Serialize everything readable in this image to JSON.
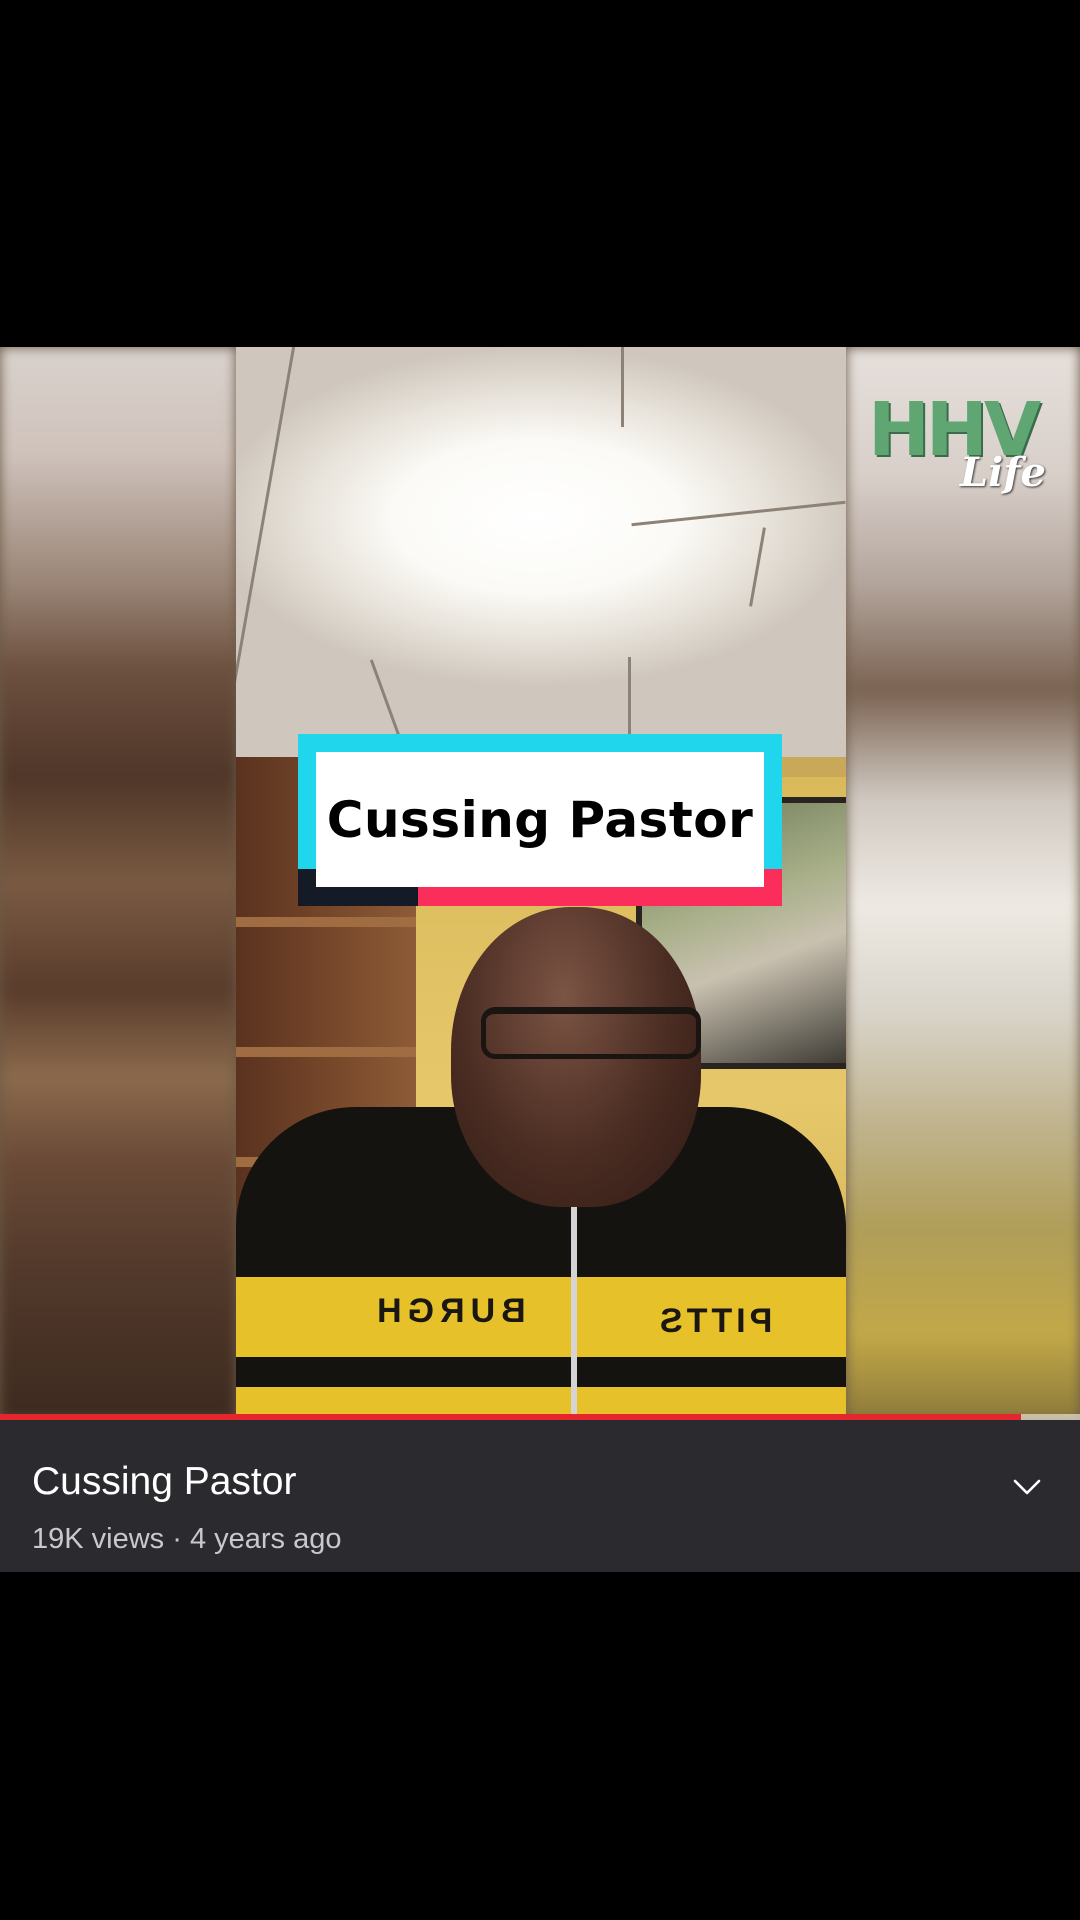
{
  "video": {
    "overlay_title": "Cussing Pastor",
    "watermark": {
      "main": "HHV",
      "sub": "Life"
    },
    "jacket_text_left": "BURGH",
    "jacket_text_right": "PITTS",
    "progress_fraction": 0.945
  },
  "info": {
    "title": "Cussing Pastor",
    "meta": "19K views · 4 years ago",
    "expand_icon": "chevron-down-icon"
  },
  "colors": {
    "progress": "#e5262c",
    "card_blue": "#1fd6ec",
    "card_red": "#fb2d5a",
    "panel_bg": "#2b2a2e"
  }
}
